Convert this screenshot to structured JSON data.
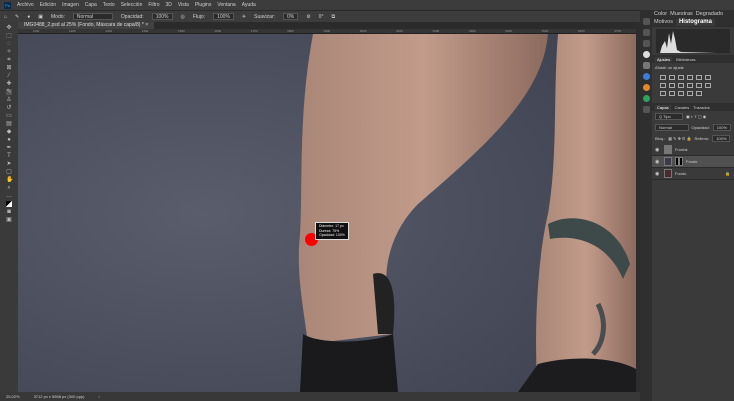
{
  "menu": [
    "Archivo",
    "Edición",
    "Imagen",
    "Capa",
    "Texto",
    "Selección",
    "Filtro",
    "3D",
    "Vista",
    "Plugins",
    "Ventana",
    "Ayuda"
  ],
  "options": {
    "mode_label": "Modo:",
    "mode": "Normal",
    "opacity_label": "Opacidad:",
    "opacity": "100%",
    "flow_label": "Flujo:",
    "flow": "100%",
    "smooth_label": "Suavizar:",
    "smooth": "0%",
    "angle": "0°"
  },
  "document_tab": "IMG0488_2.psd al 25% (Fondo, Máscara de capa/8) *",
  "ruler": [
    "1100",
    "1200",
    "1300",
    "1400",
    "1500",
    "1600",
    "1700",
    "1800",
    "1900",
    "2000",
    "2100",
    "2200",
    "2300",
    "2400",
    "2500",
    "2600",
    "2700"
  ],
  "status": {
    "zoom": "25,02%",
    "size": "3712 px x 5568 px (300 ppp)"
  },
  "brush_tip": {
    "l1": "Diámetro: 17 px",
    "l2": "Dureza: 75%",
    "l3": "Opacidad: 100%"
  },
  "panels": {
    "top_tabs": [
      "Color",
      "Muestras",
      "Degradado",
      "Motivos",
      "Histograma"
    ],
    "adj_tabs": [
      "Ajustes",
      "Bibliotecas"
    ],
    "adj_label": "Añadir un ajuste",
    "layer_tabs": [
      "Capas",
      "Canales",
      "Trazados"
    ],
    "kind": "Q Tipo",
    "blend": "Normal",
    "opacity_label": "Opacidad:",
    "opacity": "100%",
    "lock_label": "Bloq.:",
    "fill_label": "Relleno:",
    "fill": "100%",
    "layers": [
      {
        "name": "Frontal"
      },
      {
        "name": "Fondo"
      },
      {
        "name": "Fondo"
      }
    ]
  },
  "colors": {
    "canvas_bg": "#4b4e5d",
    "accent": "#31a8ff"
  }
}
